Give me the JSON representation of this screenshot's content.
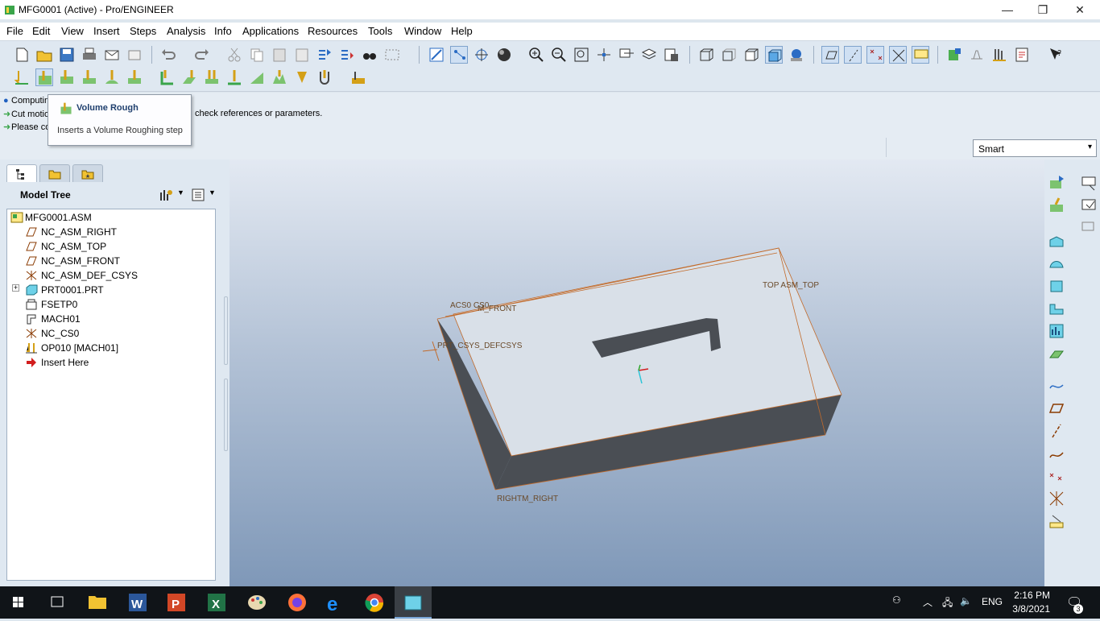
{
  "window": {
    "title": "MFG0001 (Active) - Pro/ENGINEER",
    "minimize": "—",
    "maximize": "❐",
    "close": "✕"
  },
  "menu": [
    "File",
    "Edit",
    "View",
    "Insert",
    "Steps",
    "Analysis",
    "Info",
    "Applications",
    "Resources",
    "Tools",
    "Window",
    "Help"
  ],
  "messages": [
    {
      "icon": "info-bullet",
      "text": "Computin"
    },
    {
      "icon": "green-arrow",
      "text": "Cut motio",
      "tail": "check references or parameters."
    },
    {
      "icon": "green-arrow",
      "text": "Please co"
    }
  ],
  "tooltip": {
    "title": "Volume Rough",
    "description": "Inserts a Volume Roughing step"
  },
  "filter": {
    "value": "Smart",
    "arrow": "▾"
  },
  "model_tree": {
    "title": "Model Tree",
    "items": [
      {
        "label": "MFG0001.ASM",
        "icon": "assembly-icon",
        "level": 0
      },
      {
        "label": "NC_ASM_RIGHT",
        "icon": "datum-plane-icon",
        "level": 1
      },
      {
        "label": "NC_ASM_TOP",
        "icon": "datum-plane-icon",
        "level": 1
      },
      {
        "label": "NC_ASM_FRONT",
        "icon": "datum-plane-icon",
        "level": 1
      },
      {
        "label": "NC_ASM_DEF_CSYS",
        "icon": "csys-icon",
        "level": 1
      },
      {
        "label": "PRT0001.PRT",
        "icon": "part-icon",
        "level": 1,
        "expand": "+"
      },
      {
        "label": "FSETP0",
        "icon": "fixture-setup-icon",
        "level": 1
      },
      {
        "label": "MACH01",
        "icon": "machine-icon",
        "level": 1
      },
      {
        "label": "NC_CS0",
        "icon": "csys-icon",
        "level": 1
      },
      {
        "label": "OP010 [MACH01]",
        "icon": "operation-icon",
        "level": 1
      },
      {
        "label": "Insert Here",
        "icon": "insert-arrow-icon",
        "level": 1
      }
    ]
  },
  "viewport": {
    "labels": {
      "top": "TOP ASM_TOP",
      "right": "RIGHTM_RIGHT",
      "cs0": "ACS0 CS0",
      "front": "M_FRONT",
      "csys": "PRT_CSYS_DEFCSYS"
    }
  },
  "taskbar": {
    "time": "2:16 PM",
    "date": "3/8/2021",
    "lang": "ENG",
    "notifications": "3"
  },
  "colors": {
    "accent": "#2b6cc4",
    "toolbar_bg": "#dfe8f1",
    "part_top": "#d9e0e8",
    "part_side": "#4a4e54",
    "edge": "#c26a2a"
  }
}
